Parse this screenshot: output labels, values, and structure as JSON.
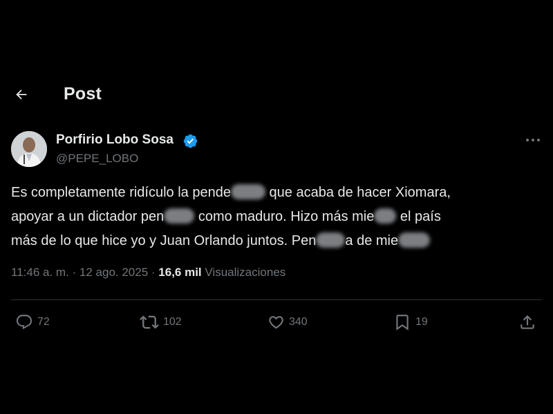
{
  "header": {
    "title": "Post"
  },
  "author": {
    "name": "Porfirio Lobo Sosa",
    "handle": "@PEPE_LOBO"
  },
  "tweet": {
    "line1_a": "Es completamente ridículo la pende",
    "line1_b": " que acaba de hacer Xiomara,",
    "line2_a": "apoyar a un dictador pen",
    "line2_b": " como maduro. Hizo más mie",
    "line2_c": " el país",
    "line3_a": "más de lo que hice yo y Juan Orlando juntos. Pen",
    "line3_b": "a de mie"
  },
  "meta": {
    "time": "11:46 a. m.",
    "separator1": " · ",
    "date": "12 ago. 2025",
    "separator2": " · ",
    "views_count": "16,6 mil",
    "views_label": " Visualizaciones"
  },
  "actions": {
    "replies": "72",
    "reposts": "102",
    "likes": "340",
    "bookmarks": "19"
  },
  "colors": {
    "background": "#000000",
    "text": "#e7e9ea",
    "secondary": "#71767b",
    "verified": "#1d9bf0",
    "divider": "#2f3336"
  }
}
